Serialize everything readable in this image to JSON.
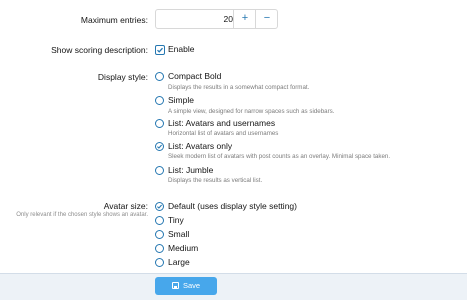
{
  "fields": {
    "max_entries": {
      "label": "Maximum entries:",
      "value": "20",
      "plus": "+",
      "minus": "−"
    },
    "scoring": {
      "label": "Show scoring description:",
      "option": "Enable",
      "checked": true
    },
    "display_style": {
      "label": "Display style:",
      "options": [
        {
          "label": "Compact Bold",
          "description": "Displays the results in a somewhat compact format.",
          "selected": false
        },
        {
          "label": "Simple",
          "description": "A simple view, designed for narrow spaces such as sidebars.",
          "selected": false
        },
        {
          "label": "List: Avatars and usernames",
          "description": "Horizontal list of avatars and usernames",
          "selected": false
        },
        {
          "label": "List: Avatars only",
          "description": "Sleek modern list of avatars with post counts as an overlay. Minimal space taken.",
          "selected": true
        },
        {
          "label": "List: Jumble",
          "description": "Displays the results as vertical list.",
          "selected": false
        }
      ]
    },
    "avatar_size": {
      "label": "Avatar size:",
      "hint": "Only relevant if the chosen style shows an avatar.",
      "options": [
        {
          "label": "Default (uses display style setting)",
          "selected": true
        },
        {
          "label": "Tiny",
          "selected": false
        },
        {
          "label": "Small",
          "selected": false
        },
        {
          "label": "Medium",
          "selected": false
        },
        {
          "label": "Large",
          "selected": false
        }
      ]
    }
  },
  "footer": {
    "save_label": "Save",
    "save_icon": "save-icon"
  },
  "colors": {
    "accent": "#2577b1",
    "button": "#47a7eb",
    "footer_bg": "#edf2f7"
  }
}
